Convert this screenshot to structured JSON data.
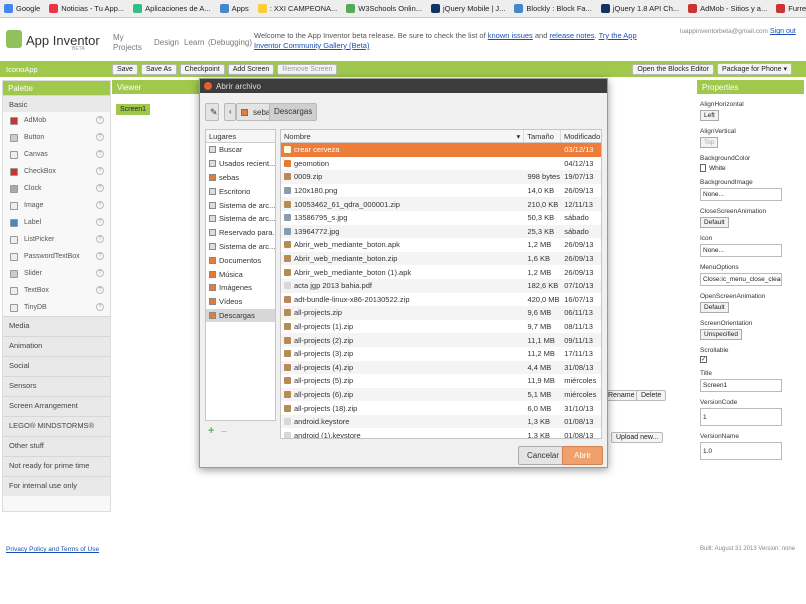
{
  "bookmarks": [
    {
      "label": "Google",
      "color": "#4285f4"
    },
    {
      "label": "Noticias - Tu App...",
      "color": "#e34"
    },
    {
      "label": "Aplicaciones de A...",
      "color": "#3b8"
    },
    {
      "label": "Apps",
      "color": "#48c"
    },
    {
      "label": ": XXI CAMPEONA...",
      "color": "#fc3"
    },
    {
      "label": "W3Schools Onlin...",
      "color": "#5a5"
    },
    {
      "label": "jQuery Mobile | J...",
      "color": "#136"
    },
    {
      "label": "Blockly : Block Fa...",
      "color": "#48c"
    },
    {
      "label": "jQuery 1.8 API Ch...",
      "color": "#136"
    },
    {
      "label": "AdMob - Sitios y a...",
      "color": "#c33"
    },
    {
      "label": "Furreal Friends C...",
      "color": "#c33"
    }
  ],
  "header": {
    "title": "App Inventor",
    "beta": "BETA",
    "nav": [
      "My Projects",
      "Design",
      "Learn",
      "(Debugging)"
    ],
    "msg_pre": "Welcome to the App Inventor beta release. Be sure to check the list of",
    "link1": "known issues",
    "msg_and": "and",
    "link2": "release notes",
    "link3": "Try the App Inventor Community Gallery (Beta)",
    "account": "luappinventorbeta@gmail.com",
    "signout": "Sign out"
  },
  "toolbar": {
    "project": "IconoApp",
    "buttons": [
      "Save",
      "Save As",
      "Checkpoint",
      "Add Screen",
      "Remove Screen"
    ],
    "blocks": "Open the Blocks Editor",
    "package": "Package for Phone ▾"
  },
  "palette": {
    "title": "Palette",
    "basic": "Basic",
    "items": [
      "AdMob",
      "Button",
      "Canvas",
      "CheckBox",
      "Clock",
      "Image",
      "Label",
      "ListPicker",
      "PasswordTextBox",
      "Slider",
      "TextBox",
      "TinyDB"
    ],
    "sections": [
      "Media",
      "Animation",
      "Social",
      "Sensors",
      "Screen Arrangement",
      "LEGO® MINDSTORMS®",
      "Other stuff",
      "Not ready for prime time",
      "For internal use only"
    ]
  },
  "viewer": {
    "title": "Viewer",
    "screen": "Screen1",
    "rename": "Rename",
    "delete": "Delete",
    "upload": "Upload new..."
  },
  "properties": {
    "title": "Properties",
    "align_h_label": "AlignHorizontal",
    "align_h": "Left",
    "align_v_label": "AlignVertical",
    "align_v": "Top",
    "bgcolor_label": "BackgroundColor",
    "bgcolor": "White",
    "bgimage_label": "BackgroundImage",
    "bgimage": "None...",
    "close_anim_label": "CloseScreenAnimation",
    "close_anim": "Default",
    "icon_label": "Icon",
    "icon": "None...",
    "menu_label": "MenuOptions",
    "menu": "Close:ic_menu_close_clear_",
    "open_anim_label": "OpenScreenAnimation",
    "open_anim": "Default",
    "orient_label": "ScreenOrientation",
    "orient": "Unspecified",
    "scroll_label": "Scrollable",
    "title_label": "Title",
    "title_val": "Screen1",
    "vcode_label": "VersionCode",
    "vcode": "1",
    "vname_label": "VersionName",
    "vname": "1.0"
  },
  "footer": {
    "privacy": "Privacy Policy and Terms of Use",
    "build": "Built: August 31 2013 Version: none"
  },
  "dialog": {
    "title": "Abrir archivo",
    "path": [
      "sebas",
      "Descargas"
    ],
    "places_header": "Lugares",
    "places": [
      "Buscar",
      "Usados recient...",
      "sebas",
      "Escritorio",
      "Sistema de arc...",
      "Sistema de arc...",
      "Reservado para...",
      "Sistema de arc...",
      "Documentos",
      "Música",
      "Imágenes",
      "Vídeos",
      "Descargas"
    ],
    "columns": [
      "Nombre",
      "Tamaño",
      "Modificado"
    ],
    "files": [
      {
        "name": "crear cerveza",
        "size": "",
        "date": "03/12/13",
        "kind": "folder"
      },
      {
        "name": "geomotion",
        "size": "",
        "date": "04/12/13",
        "kind": "folder"
      },
      {
        "name": "0009.zip",
        "size": "998 bytes",
        "date": "19/07/13",
        "kind": "zip"
      },
      {
        "name": "120x180.png",
        "size": "14,0 KB",
        "date": "26/09/13",
        "kind": "img"
      },
      {
        "name": "10053462_61_qdra_000001.zip",
        "size": "210,0 KB",
        "date": "12/11/13",
        "kind": "zip"
      },
      {
        "name": "13586795_s.jpg",
        "size": "50,3 KB",
        "date": "sábado",
        "kind": "img"
      },
      {
        "name": "13964772.jpg",
        "size": "25,3 KB",
        "date": "sábado",
        "kind": "img"
      },
      {
        "name": "Abrir_web_mediante_boton.apk",
        "size": "1,2 MB",
        "date": "26/09/13",
        "kind": "zip"
      },
      {
        "name": "Abrir_web_mediante_boton.zip",
        "size": "1,6 KB",
        "date": "26/09/13",
        "kind": "zip"
      },
      {
        "name": "Abrir_web_mediante_boton (1).apk",
        "size": "1,2 MB",
        "date": "26/09/13",
        "kind": "zip"
      },
      {
        "name": "acta jgp 2013 bahia.pdf",
        "size": "182,6 KB",
        "date": "07/10/13",
        "kind": "doc"
      },
      {
        "name": "adt-bundle-linux-x86-20130522.zip",
        "size": "420,0 MB",
        "date": "16/07/13",
        "kind": "zip"
      },
      {
        "name": "all-projects.zip",
        "size": "9,6 MB",
        "date": "06/11/13",
        "kind": "zip"
      },
      {
        "name": "all-projects (1).zip",
        "size": "9,7 MB",
        "date": "08/11/13",
        "kind": "zip"
      },
      {
        "name": "all-projects (2).zip",
        "size": "11,1 MB",
        "date": "09/11/13",
        "kind": "zip"
      },
      {
        "name": "all-projects (3).zip",
        "size": "11,2 MB",
        "date": "17/11/13",
        "kind": "zip"
      },
      {
        "name": "all-projects (4).zip",
        "size": "4,4 MB",
        "date": "31/08/13",
        "kind": "zip"
      },
      {
        "name": "all-projects (5).zip",
        "size": "11,9 MB",
        "date": "miércoles",
        "kind": "zip"
      },
      {
        "name": "all-projects (6).zip",
        "size": "5,1 MB",
        "date": "miércoles",
        "kind": "zip"
      },
      {
        "name": "all-projects (18).zip",
        "size": "6,0 MB",
        "date": "31/10/13",
        "kind": "zip"
      },
      {
        "name": "android.keystore",
        "size": "1,3 KB",
        "date": "01/08/13",
        "kind": "doc"
      },
      {
        "name": "android (1).keystore",
        "size": "1,3 KB",
        "date": "01/08/13",
        "kind": "doc"
      }
    ],
    "cancel": "Cancelar",
    "open": "Abrir"
  },
  "colors": {
    "green": "#9fc84d",
    "orange": "#ec7d3a",
    "dark": "#3c3c3c"
  }
}
